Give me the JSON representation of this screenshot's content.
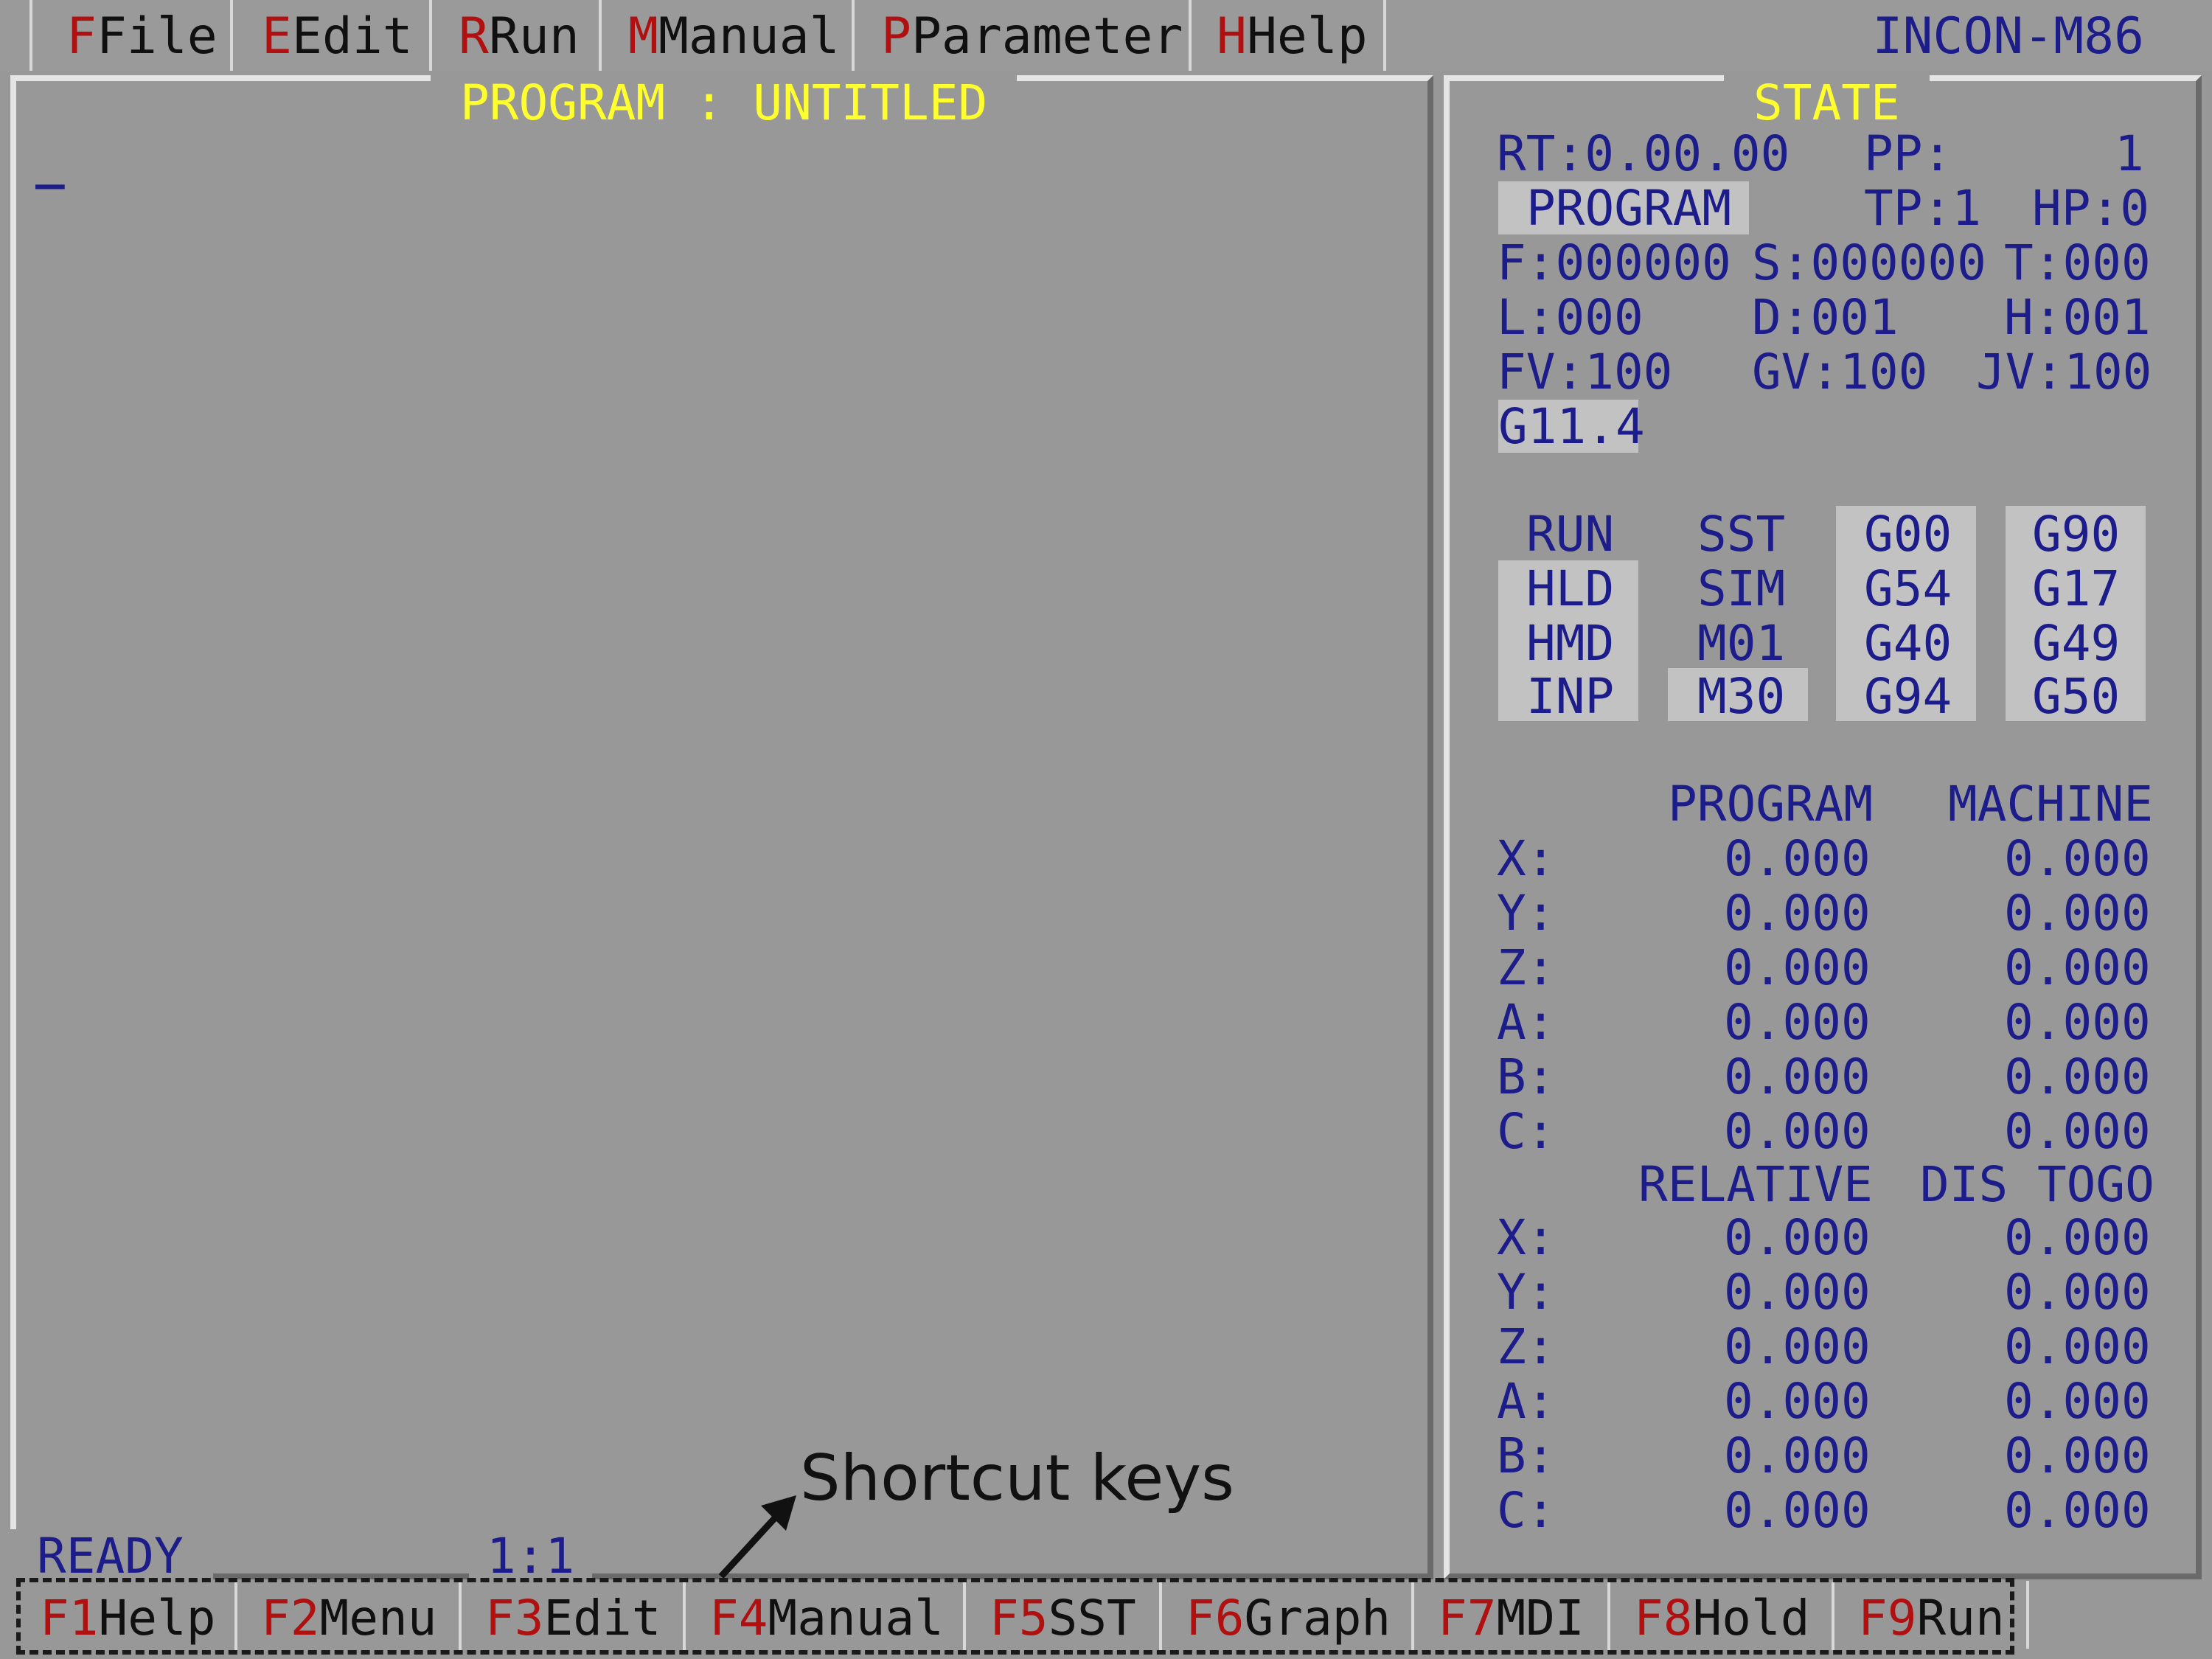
{
  "menu": [
    {
      "hot": "F",
      "label": "File"
    },
    {
      "hot": "E",
      "label": "Edit"
    },
    {
      "hot": "R",
      "label": "Run"
    },
    {
      "hot": "M",
      "label": "Manual"
    },
    {
      "hot": "P",
      "label": "Parameter"
    },
    {
      "hot": "H",
      "label": "Help"
    }
  ],
  "brand": "INCON-M86",
  "program": {
    "title": "PROGRAM : UNTITLED",
    "cursor": "_",
    "status": "READY",
    "position": "1:1"
  },
  "state": {
    "title": "STATE",
    "rt": "RT:0.00.00",
    "pp_label": "PP:",
    "pp_value": "1",
    "mode": "PROGRAM",
    "tp": "TP:1",
    "hp": "HP:0",
    "f": "F:000000",
    "s": "S:000000",
    "t": "T:000",
    "l": "L:000",
    "d": "D:001",
    "h": "H:001",
    "fv": "FV:100",
    "gv": "GV:100",
    "jv": "JV:100",
    "g_code": "G11.4",
    "flags": [
      [
        "RUN",
        "SST",
        "G00",
        "G90"
      ],
      [
        "HLD",
        "SIM",
        "G54",
        "G17"
      ],
      [
        "HMD",
        "M01",
        "G40",
        "G49"
      ],
      [
        "INP",
        "M30",
        "G94",
        "G50"
      ]
    ]
  },
  "coords": {
    "header1": [
      "PROGRAM",
      "MACHINE"
    ],
    "rows1": [
      {
        "axis": "X:",
        "a": "0.000",
        "b": "0.000"
      },
      {
        "axis": "Y:",
        "a": "0.000",
        "b": "0.000"
      },
      {
        "axis": "Z:",
        "a": "0.000",
        "b": "0.000"
      },
      {
        "axis": "A:",
        "a": "0.000",
        "b": "0.000"
      },
      {
        "axis": "B:",
        "a": "0.000",
        "b": "0.000"
      },
      {
        "axis": "C:",
        "a": "0.000",
        "b": "0.000"
      }
    ],
    "header2": [
      "RELATIVE",
      "DIS TOGO"
    ],
    "rows2": [
      {
        "axis": "X:",
        "a": "0.000",
        "b": "0.000"
      },
      {
        "axis": "Y:",
        "a": "0.000",
        "b": "0.000"
      },
      {
        "axis": "Z:",
        "a": "0.000",
        "b": "0.000"
      },
      {
        "axis": "A:",
        "a": "0.000",
        "b": "0.000"
      },
      {
        "axis": "B:",
        "a": "0.000",
        "b": "0.000"
      },
      {
        "axis": "C:",
        "a": "0.000",
        "b": "0.000"
      }
    ]
  },
  "fkeys": [
    {
      "key": "F1",
      "label": "Help"
    },
    {
      "key": "F2",
      "label": "Menu"
    },
    {
      "key": "F3",
      "label": "Edit"
    },
    {
      "key": "F4",
      "label": "Manual"
    },
    {
      "key": "F5",
      "label": "SST"
    },
    {
      "key": "F6",
      "label": "Graph"
    },
    {
      "key": "F7",
      "label": "MDI"
    },
    {
      "key": "F8",
      "label": "Hold"
    },
    {
      "key": "F9",
      "label": "Run"
    }
  ],
  "annotation": "Shortcut keys",
  "colors": {
    "background": "#989898",
    "text": "#1c1c8a",
    "hotkey": "#b01010",
    "title": "#ffff30"
  }
}
